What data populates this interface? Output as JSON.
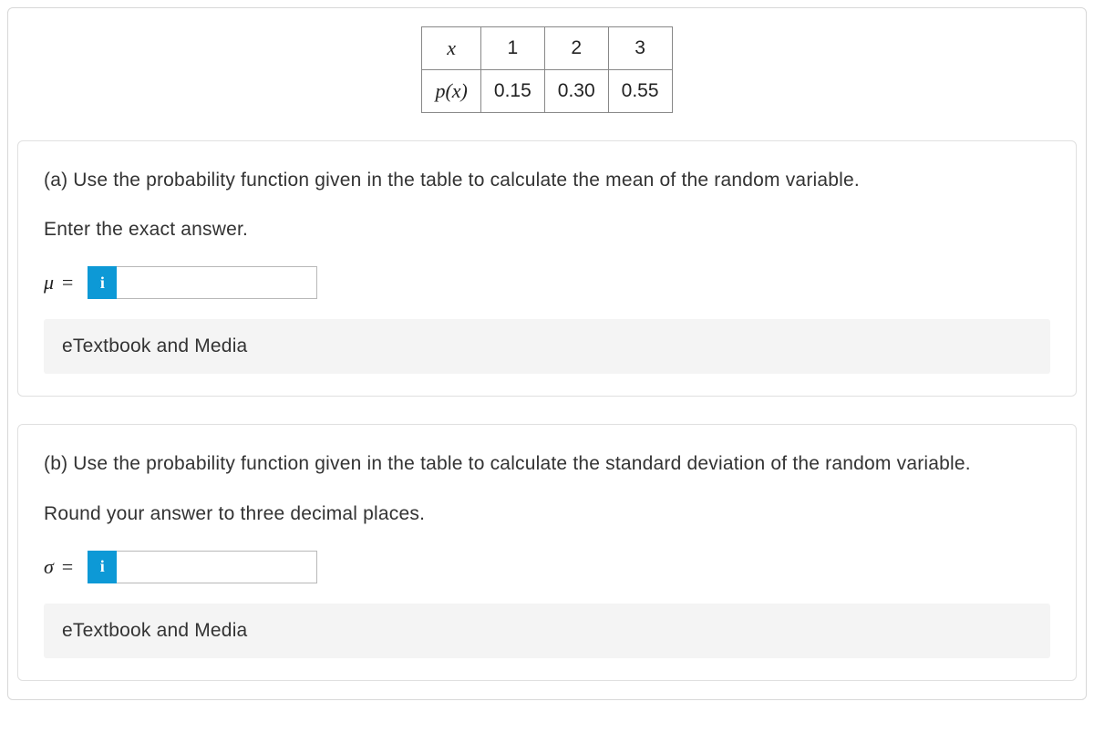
{
  "table": {
    "row1": {
      "label": "x",
      "c1": "1",
      "c2": "2",
      "c3": "3"
    },
    "row2": {
      "label": "p(x)",
      "c1": "0.15",
      "c2": "0.30",
      "c3": "0.55"
    }
  },
  "partA": {
    "question": "(a) Use the probability function given in the table to calculate the mean of the random variable.",
    "instruction": "Enter the exact answer.",
    "label": "μ =",
    "infoIcon": "i",
    "textbookLink": "eTextbook and Media"
  },
  "partB": {
    "question": "(b) Use the probability function given in the table to calculate the standard deviation of the random variable.",
    "instruction": "Round your answer to three decimal places.",
    "label": "σ =",
    "infoIcon": "i",
    "textbookLink": "eTextbook and Media"
  }
}
